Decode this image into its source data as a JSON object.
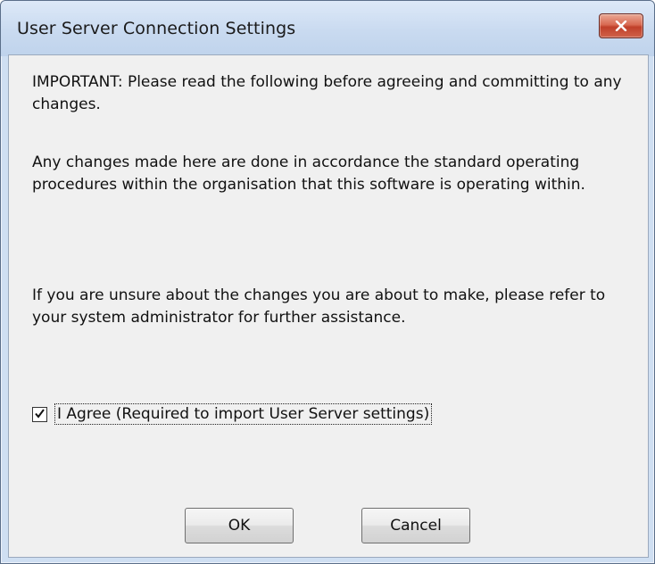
{
  "window": {
    "title": "User Server Connection Settings"
  },
  "content": {
    "important_text": "IMPORTANT: Please read the following before agreeing and committing to any changes.",
    "policy_text": "Any changes made here are done in accordance the standard operating procedures within the organisation that this software is operating within.",
    "help_text": "If you are unsure about the changes you are about to make, please refer to your system administrator for further assistance."
  },
  "agreement": {
    "checked": true,
    "label": "I Agree (Required to import User Server settings)"
  },
  "buttons": {
    "ok_label": "OK",
    "cancel_label": "Cancel"
  },
  "icons": {
    "close": "close-icon",
    "checkmark": "checkmark-icon"
  }
}
